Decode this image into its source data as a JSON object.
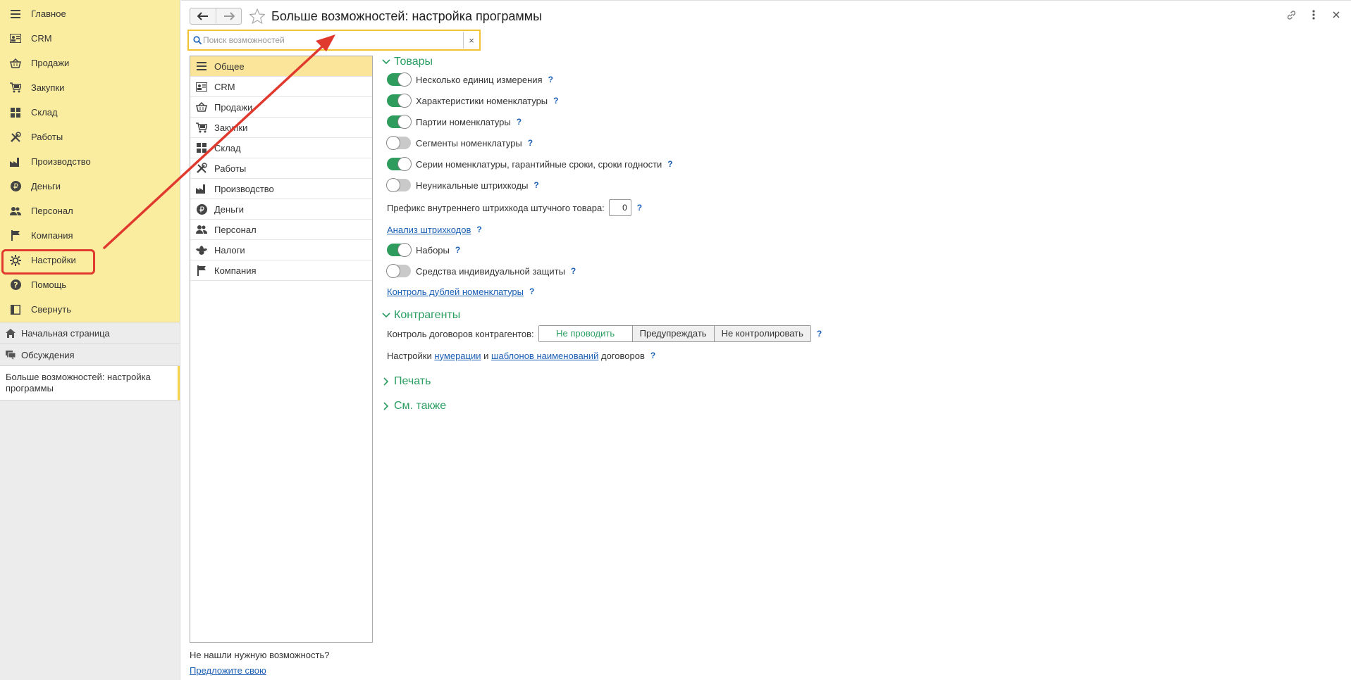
{
  "sidebar": {
    "menu": [
      {
        "label": "Главное",
        "icon": "hamburger-icon"
      },
      {
        "label": "CRM",
        "icon": "crm-card-icon"
      },
      {
        "label": "Продажи",
        "icon": "basket-icon"
      },
      {
        "label": "Закупки",
        "icon": "cart-icon"
      },
      {
        "label": "Склад",
        "icon": "grid-icon"
      },
      {
        "label": "Работы",
        "icon": "tools-icon"
      },
      {
        "label": "Производство",
        "icon": "factory-icon"
      },
      {
        "label": "Деньги",
        "icon": "ruble-icon"
      },
      {
        "label": "Персонал",
        "icon": "people-icon"
      },
      {
        "label": "Компания",
        "icon": "flag-icon"
      },
      {
        "label": "Настройки",
        "icon": "gear-icon"
      },
      {
        "label": "Помощь",
        "icon": "help-icon"
      },
      {
        "label": "Свернуть",
        "icon": "collapse-icon"
      }
    ],
    "home_label": "Начальная страница",
    "discussions_label": "Обсуждения",
    "open_window_label": "Больше возможностей: настройка программы"
  },
  "header": {
    "title": "Больше возможностей: настройка программы"
  },
  "search": {
    "placeholder": "Поиск возможностей",
    "value": "",
    "clear": "×"
  },
  "sections": [
    {
      "label": "Общее",
      "icon": "hamburger-icon"
    },
    {
      "label": "CRM",
      "icon": "crm-card-icon"
    },
    {
      "label": "Продажи",
      "icon": "basket-icon"
    },
    {
      "label": "Закупки",
      "icon": "cart-icon"
    },
    {
      "label": "Склад",
      "icon": "grid-icon"
    },
    {
      "label": "Работы",
      "icon": "tools-icon"
    },
    {
      "label": "Производство",
      "icon": "factory-icon"
    },
    {
      "label": "Деньги",
      "icon": "ruble-icon"
    },
    {
      "label": "Персонал",
      "icon": "people-icon"
    },
    {
      "label": "Налоги",
      "icon": "emblem-icon"
    },
    {
      "label": "Компания",
      "icon": "flag-icon"
    }
  ],
  "footer": {
    "not_found": "Не нашли нужную возможность?",
    "suggest": "Предложите свою"
  },
  "content": {
    "goods": {
      "title": "Товары",
      "options": [
        {
          "label": "Несколько единиц измерения",
          "on": true
        },
        {
          "label": "Характеристики номенклатуры",
          "on": true
        },
        {
          "label": "Партии номенклатуры",
          "on": true
        },
        {
          "label": "Сегменты номенклатуры",
          "on": false
        },
        {
          "label": "Серии номенклатуры, гарантийные сроки, сроки годности",
          "on": true
        },
        {
          "label": "Неуникальные штрихкоды",
          "on": false
        }
      ],
      "prefix_label": "Префикс внутреннего штрихкода штучного товара:",
      "prefix_value": "0",
      "barcode_link": "Анализ штрихкодов",
      "options2": [
        {
          "label": "Наборы",
          "on": true
        },
        {
          "label": "Средства индивидуальной защиты",
          "on": false
        }
      ],
      "duplicates_link": "Контроль дублей номенклатуры"
    },
    "contractors": {
      "title": "Контрагенты",
      "control_label": "Контроль договоров контрагентов:",
      "segments": [
        "Не проводить",
        "Предупреждать",
        "Не контролировать"
      ],
      "settings_prefix": "Настройки",
      "numbering_link": "нумерации",
      "and": "и",
      "templates_link": "шаблонов наименований",
      "settings_suffix": "договоров"
    },
    "print_title": "Печать",
    "see_also_title": "См. также",
    "help_mark": "?"
  }
}
